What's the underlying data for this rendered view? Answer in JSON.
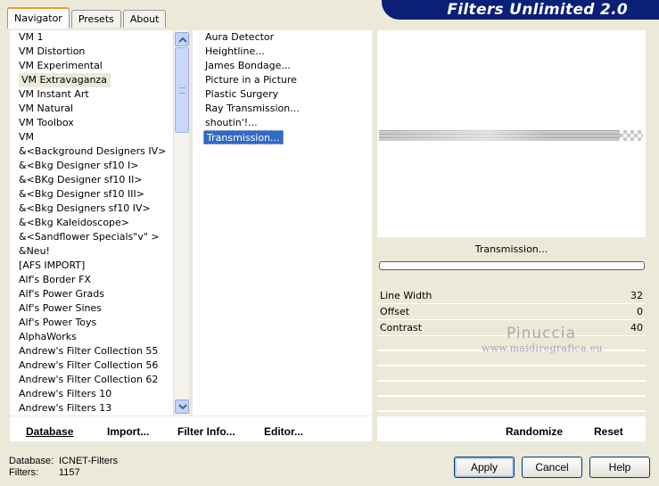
{
  "tabs": [
    {
      "label": "Navigator",
      "active": true
    },
    {
      "label": "Presets",
      "active": false
    },
    {
      "label": "About",
      "active": false
    }
  ],
  "header": {
    "title": "Filters Unlimited 2.0"
  },
  "categories": {
    "items": [
      "VM 1",
      "VM Distortion",
      "VM Experimental",
      "VM Extravaganza",
      "VM Instant Art",
      "VM Natural",
      "VM Toolbox",
      "VM",
      "&<Background Designers IV>",
      "&<Bkg Designer sf10 I>",
      "&<BKg Designer sf10 II>",
      "&<Bkg Designer sf10 III>",
      "&<Bkg Designers sf10 IV>",
      "&<Bkg Kaleidoscope>",
      "&<Sandflower Specials\"v\" >",
      "&Neu!",
      "[AFS IMPORT]",
      "Alf's Border FX",
      "Alf's Power Grads",
      "Alf's Power Sines",
      "Alf's Power Toys",
      "AlphaWorks",
      "Andrew's Filter Collection 55",
      "Andrew's Filter Collection 56",
      "Andrew's Filter Collection 62",
      "Andrew's Filters 10",
      "Andrew's Filters 13"
    ],
    "selected_index": 3
  },
  "filters": {
    "items": [
      "Aura Detector",
      "Heightline...",
      "James Bondage...",
      "Picture in a Picture",
      "Plastic Surgery",
      "Ray Transmission...",
      "shoutin'!...",
      "Transmission..."
    ],
    "selected_index": 7
  },
  "preview": {
    "filter_name": "Transmission..."
  },
  "params": [
    {
      "label": "Line Width",
      "value": "32"
    },
    {
      "label": "Offset",
      "value": "0"
    },
    {
      "label": "Contrast",
      "value": "40"
    }
  ],
  "watermark": {
    "line1": "Pinuccia",
    "line2": "www.maidiregrafica.eu"
  },
  "bottom_links": {
    "database": "Database",
    "import": "Import...",
    "filter_info": "Filter Info...",
    "editor": "Editor...",
    "randomize": "Randomize",
    "reset": "Reset"
  },
  "status": {
    "database_label": "Database:",
    "database_value": "ICNET-Filters",
    "filters_label": "Filters:",
    "filters_value": "1157"
  },
  "buttons": {
    "apply": "Apply",
    "cancel": "Cancel",
    "help": "Help"
  }
}
